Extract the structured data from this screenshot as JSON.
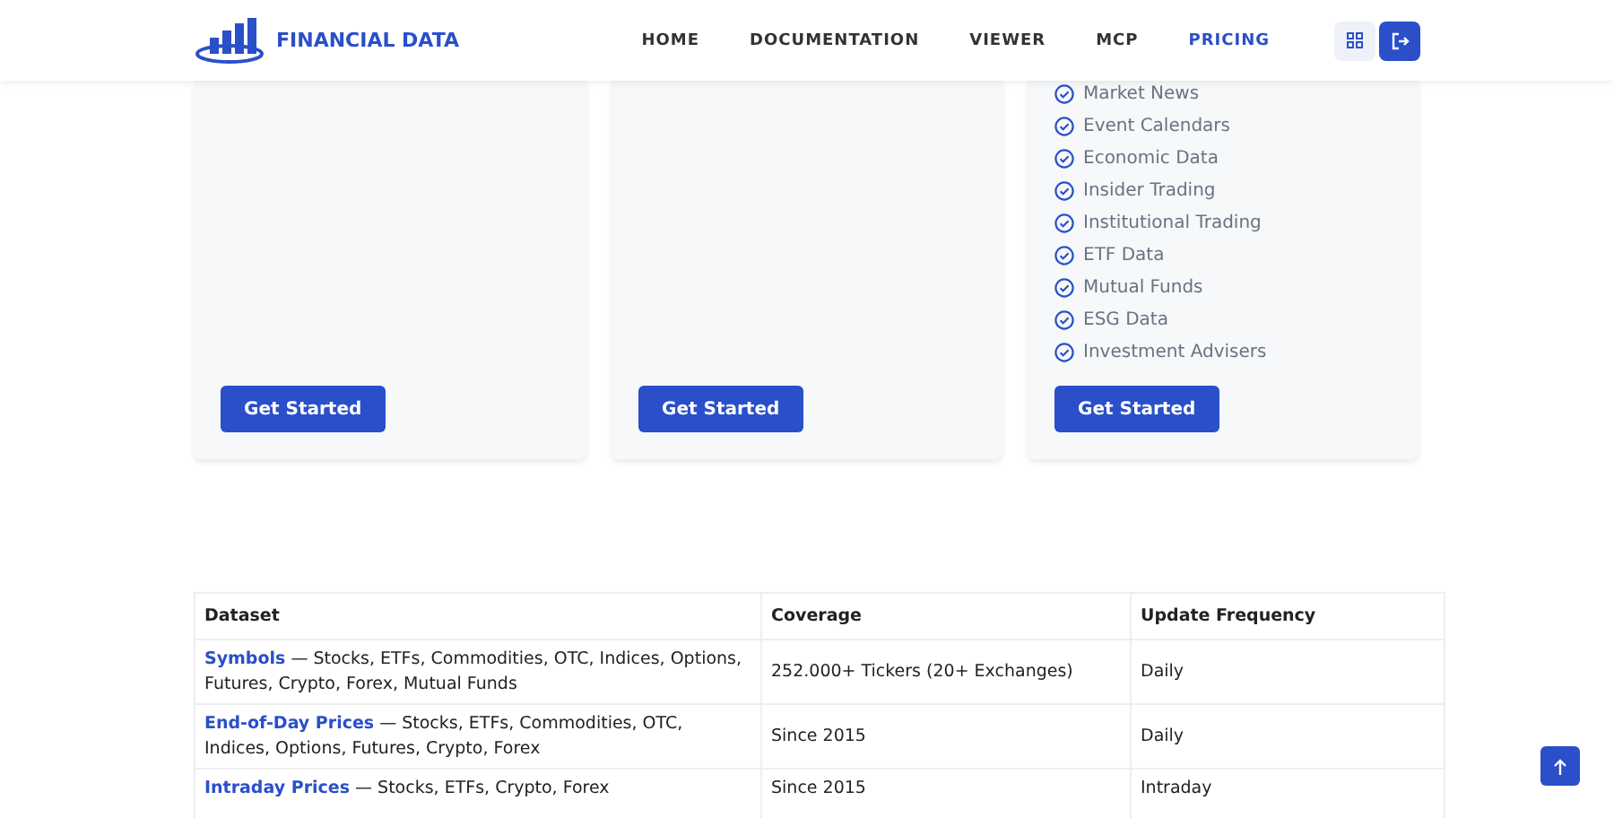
{
  "header": {
    "logo_text": "FINANCIAL DATA",
    "nav": [
      {
        "label": "HOME",
        "selected": false
      },
      {
        "label": "DOCUMENTATION",
        "selected": false
      },
      {
        "label": "VIEWER",
        "selected": false
      },
      {
        "label": "MCP",
        "selected": false
      },
      {
        "label": "PRICING",
        "selected": true
      }
    ]
  },
  "plans": [
    {
      "button": "Get Started"
    },
    {
      "button": "Get Started"
    },
    {
      "features": [
        "Market News",
        "Event Calendars",
        "Economic Data",
        "Insider Trading",
        "Institutional Trading",
        "ETF Data",
        "Mutual Funds",
        "ESG Data",
        "Investment Advisers"
      ],
      "button": "Get Started"
    }
  ],
  "table": {
    "columns": [
      "Dataset",
      "Coverage",
      "Update Frequency"
    ],
    "rows": [
      {
        "dataset": "Symbols",
        "description": " — Stocks, ETFs, Commodities, OTC, Indices, Options, Futures, Crypto, Forex, Mutual Funds",
        "coverage": "252.000+ Tickers (20+ Exchanges)",
        "frequency": "Daily"
      },
      {
        "dataset": "End-of-Day Prices",
        "description": " — Stocks, ETFs, Commodities, OTC, Indices, Options, Futures, Crypto, Forex",
        "coverage": "Since 2015",
        "frequency": "Daily"
      },
      {
        "dataset": "Intraday Prices",
        "description": " — Stocks, ETFs, Crypto, Forex",
        "coverage": "Since 2015",
        "frequency": "Intraday"
      }
    ]
  }
}
